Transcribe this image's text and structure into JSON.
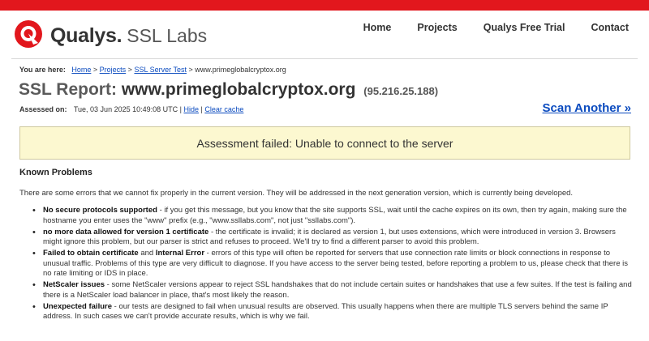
{
  "brand": {
    "name": "Qualys.",
    "product": "SSL Labs"
  },
  "nav": [
    {
      "label": "Home"
    },
    {
      "label": "Projects"
    },
    {
      "label": "Qualys Free Trial"
    },
    {
      "label": "Contact"
    }
  ],
  "breadcrumb": {
    "label": "You are here:",
    "links": [
      "Home",
      "Projects",
      "SSL Server Test"
    ],
    "sep": " > ",
    "current": "www.primeglobalcryptox.org"
  },
  "report": {
    "prefix": "SSL Report:",
    "host": "www.primeglobalcryptox.org",
    "ip": "(95.216.25.188)"
  },
  "assessed": {
    "label": "Assessed on:",
    "value": "Tue, 03 Jun 2025 10:49:08 UTC",
    "sep": " | ",
    "hide": "Hide",
    "clear": "Clear cache"
  },
  "scan_another": "Scan Another »",
  "failure_message": "Assessment failed: Unable to connect to the server",
  "known_problems": {
    "title": "Known Problems",
    "intro": "There are some errors that we cannot fix properly in the current version. They will be addressed in the next generation version, which is currently being developed.",
    "items": [
      {
        "title": "No secure protocols supported",
        "text": " - if you get this message, but you know that the site supports SSL, wait until the cache expires on its own, then try again, making sure the hostname you enter uses the \"www\" prefix (e.g., \"www.ssllabs.com\", not just \"ssllabs.com\")."
      },
      {
        "title": "no more data allowed for version 1 certificate",
        "text": " - the certificate is invalid; it is declared as version 1, but uses extensions, which were introduced in version 3. Browsers might ignore this problem, but our parser is strict and refuses to proceed. We'll try to find a different parser to avoid this problem."
      },
      {
        "title": "Failed to obtain certificate",
        "mid": " and ",
        "title2": "Internal Error",
        "text": " - errors of this type will often be reported for servers that use connection rate limits or block connections in response to unusual traffic. Problems of this type are very difficult to diagnose. If you have access to the server being tested, before reporting a problem to us, please check that there is no rate limiting or IDS in place."
      },
      {
        "title": "NetScaler issues",
        "text": " - some NetScaler versions appear to reject SSL handshakes that do not include certain suites or handshakes that use a few suites. If the test is failing and there is a NetScaler load balancer in place, that's most likely the reason."
      },
      {
        "title": "Unexpected failure",
        "text": " - our tests are designed to fail when unusual results are observed. This usually happens when there are multiple TLS servers behind the same IP address. In such cases we can't provide accurate results, which is why we fail."
      }
    ]
  },
  "colors": {
    "accent_red": "#e2171d",
    "link": "#0b4bbf",
    "warning_bg": "#fcf8d0"
  }
}
